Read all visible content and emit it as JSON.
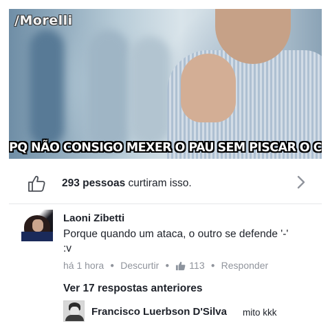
{
  "meme": {
    "watermark": "/Morelli",
    "caption": "PQ NÃO CONSIGO MEXER O PAU SEM PISCAR O CU?"
  },
  "likes": {
    "count": "293 pessoas",
    "suffix": " curtiram isso."
  },
  "comment": {
    "author": "Laoni Zibetti",
    "text": "Porque quando um ataca, o outro se defende '-' :v",
    "time": "há 1 hora",
    "dislike_label": "Descurtir",
    "like_count": "113",
    "reply_label": "Responder"
  },
  "replies": {
    "see_previous": "Ver 17 respostas anteriores",
    "latest": {
      "author": "Francisco Luerbson D'Silva",
      "text": "mito kkk"
    }
  },
  "colors": {
    "text": "#1d2129",
    "meta": "#90949c",
    "accent": "#4267b2"
  }
}
